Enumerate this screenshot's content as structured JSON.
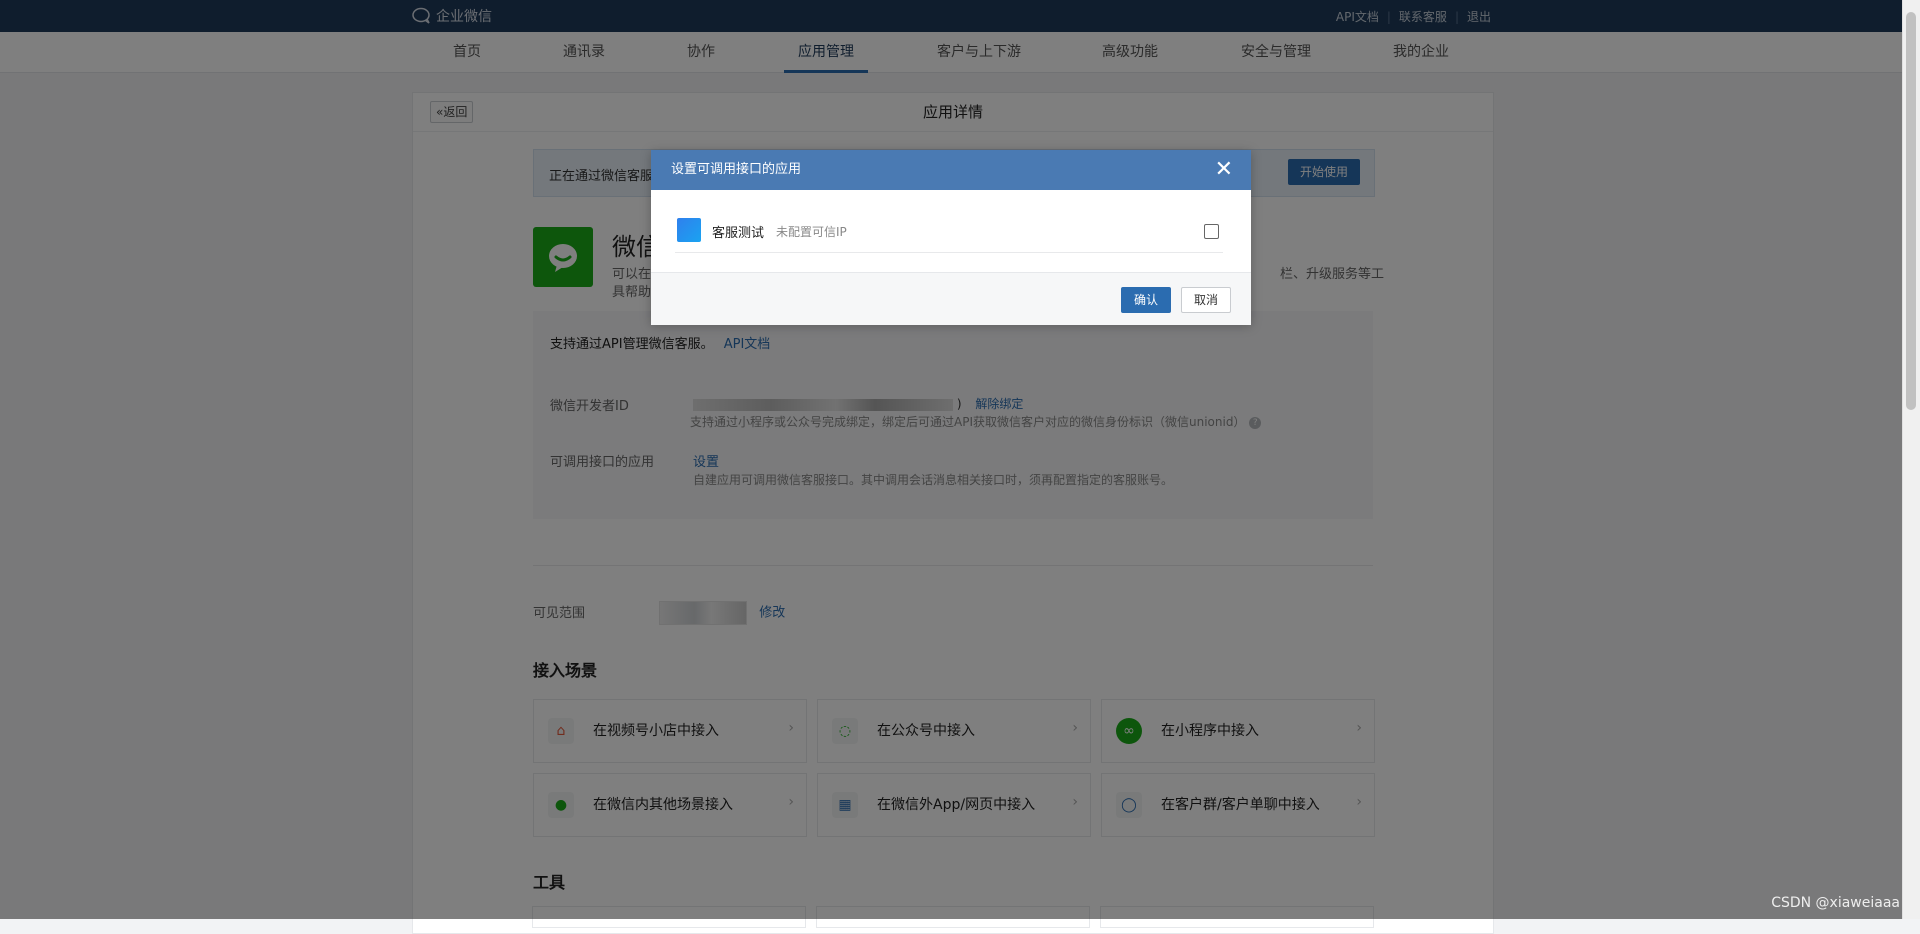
{
  "topbar": {
    "brand": "企业微信",
    "links": [
      "API文档",
      "联系客服",
      "退出"
    ]
  },
  "nav": {
    "items": [
      "首页",
      "通讯录",
      "协作",
      "应用管理",
      "客户与上下游",
      "高级功能",
      "安全与管理",
      "我的企业"
    ],
    "active": "应用管理"
  },
  "page": {
    "back_label": "返回",
    "title": "应用详情",
    "notice_text": "正在通过微信客服",
    "notice_button": "开始使用",
    "app_name": "微信",
    "app_desc_line1": "可以在",
    "app_desc_line2": "具帮助",
    "app_desc_right": "栏、升级服务等工",
    "api": {
      "intro": "支持通过API管理微信客服。",
      "intro_link": "API文档",
      "dev_id_label": "微信开发者ID",
      "dev_id_suffix": ")",
      "unbind_link": "解除绑定",
      "dev_id_hint": "支持通过小程序或公众号完成绑定，绑定后可通过API获取微信客户对应的微信身份标识（微信unionid）",
      "callable_label": "可调用接口的应用",
      "callable_link": "设置",
      "callable_hint": "自建应用可调用微信客服接口。其中调用会话消息相关接口时，须再配置指定的客服账号。"
    },
    "visibility": {
      "label": "可见范围",
      "edit_link": "修改"
    },
    "scenes_title": "接入场景",
    "scenes": [
      {
        "label": "在视频号小店中接入",
        "icon": "shop-icon"
      },
      {
        "label": "在公众号中接入",
        "icon": "official-account-icon"
      },
      {
        "label": "在小程序中接入",
        "icon": "mini-program-icon"
      },
      {
        "label": "在微信内其他场景接入",
        "icon": "wechat-icon"
      },
      {
        "label": "在微信外App/网页中接入",
        "icon": "app-grid-icon"
      },
      {
        "label": "在客户群/客户单聊中接入",
        "icon": "chat-icon"
      }
    ],
    "tools_title": "工具"
  },
  "modal": {
    "title": "设置可调用接口的应用",
    "app_name": "客服测试",
    "app_status": "未配置可信IP",
    "checked": false,
    "confirm_label": "确认",
    "cancel_label": "取消"
  },
  "watermark": "CSDN @xiaweiaaa"
}
